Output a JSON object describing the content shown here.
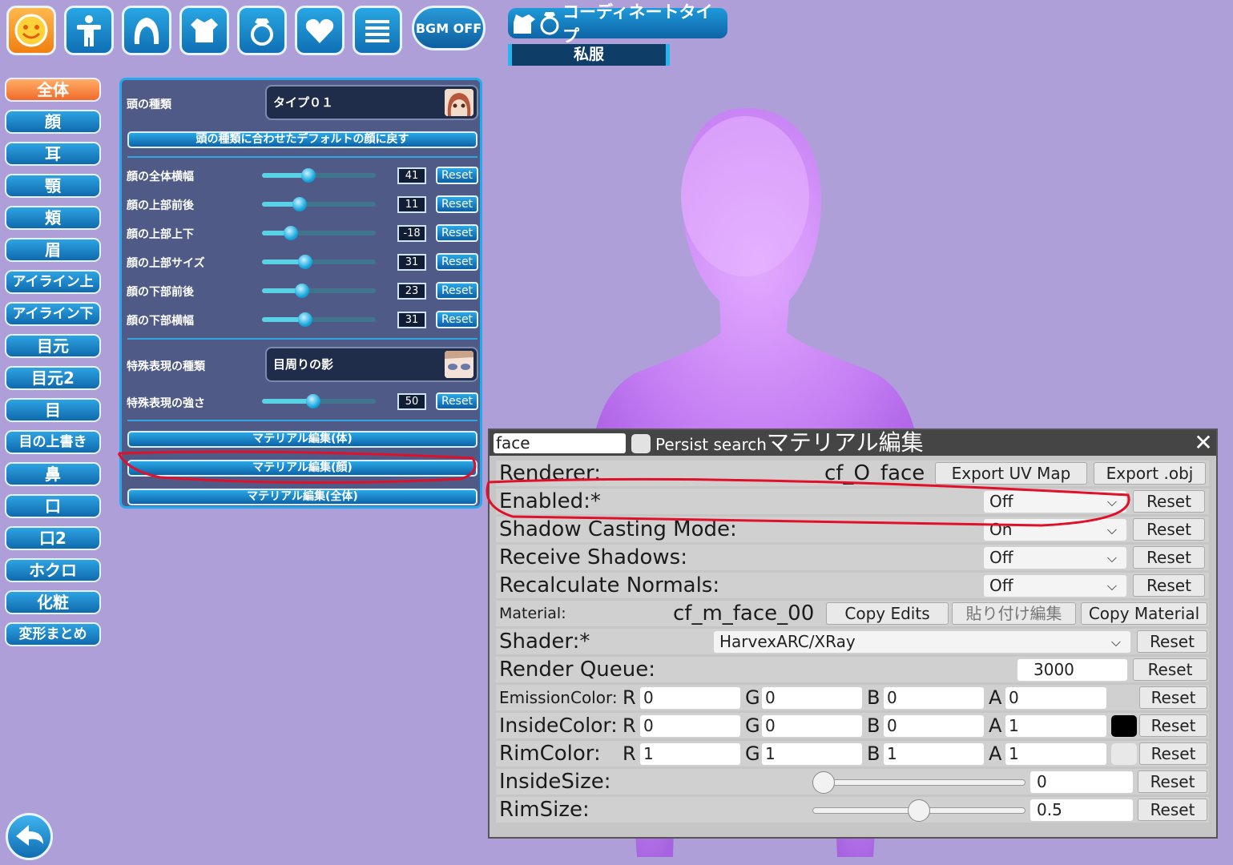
{
  "top_bar": {
    "icons": [
      "smiley-icon",
      "body-icon",
      "hair-icon",
      "outfit-icon",
      "ring-icon",
      "heart-icon",
      "list-icon"
    ],
    "bgm_label": "BGM OFF",
    "coordinate_title": "コーディネートタイプ",
    "coordinate_value": "私服"
  },
  "categories": [
    "全体",
    "顔",
    "耳",
    "顎",
    "頬",
    "眉",
    "アイライン上",
    "アイライン下",
    "目元",
    "目元2",
    "目",
    "目の上書き",
    "鼻",
    "口",
    "口2",
    "ホクロ",
    "化粧",
    "変形まとめ"
  ],
  "face_panel": {
    "head_type_label": "頭の種類",
    "head_type_value": "タイプ０１",
    "default_face_button": "頭の種類に合わせたデフォルトの顔に戻す",
    "sliders": [
      {
        "label": "顔の全体横幅",
        "value": "41",
        "fraction": 0.41
      },
      {
        "label": "顔の上部前後",
        "value": "11",
        "fraction": 0.33
      },
      {
        "label": "顔の上部上下",
        "value": "-18",
        "fraction": 0.25
      },
      {
        "label": "顔の上部サイズ",
        "value": "31",
        "fraction": 0.38
      },
      {
        "label": "顔の下部前後",
        "value": "23",
        "fraction": 0.35
      },
      {
        "label": "顔の下部横幅",
        "value": "31",
        "fraction": 0.38
      }
    ],
    "special_type_label": "特殊表現の種類",
    "special_type_value": "目周りの影",
    "special_strength": {
      "label": "特殊表現の強さ",
      "value": "50",
      "fraction": 0.45
    },
    "reset_label": "Reset",
    "material_buttons": [
      "マテリアル編集(体)",
      "マテリアル編集(顔)",
      "マテリアル編集(全体)"
    ]
  },
  "material_editor": {
    "search_value": "face",
    "persist_label": "Persist search",
    "title": "マテリアル編集",
    "renderer_label": "Renderer:",
    "renderer_value": "cf_O_face",
    "export_uv": "Export UV Map",
    "export_obj": "Export .obj",
    "enabled": {
      "label": "Enabled:*",
      "value": "Off"
    },
    "shadow_casting": {
      "label": "Shadow Casting Mode:",
      "value": "On"
    },
    "receive_shadows": {
      "label": "Receive Shadows:",
      "value": "Off"
    },
    "recalc_normals": {
      "label": "Recalculate Normals:",
      "value": "Off"
    },
    "material_label": "Material:",
    "material_value": "cf_m_face_00",
    "copy_edits": "Copy Edits",
    "paste_edits": "貼り付け編集",
    "copy_material": "Copy Material",
    "shader": {
      "label": "Shader:*",
      "value": "HarvexARC/XRay"
    },
    "render_queue": {
      "label": "Render Queue:",
      "value": "3000"
    },
    "emission": {
      "label": "EmissionColor:",
      "r": "0",
      "g": "0",
      "b": "0",
      "a": "0"
    },
    "inside": {
      "label": "InsideColor:",
      "r": "0",
      "g": "0",
      "b": "0",
      "a": "1",
      "swatch": "#000000"
    },
    "rim": {
      "label": "RimColor:",
      "r": "1",
      "g": "1",
      "b": "1",
      "a": "1",
      "swatch": "#e8e8e8"
    },
    "inside_size": {
      "label": "InsideSize:",
      "value": "0",
      "fraction": 0.0
    },
    "rim_size": {
      "label": "RimSize:",
      "value": "0.5",
      "fraction": 0.5
    },
    "channel_labels": {
      "r": "R",
      "g": "G",
      "b": "B",
      "a": "A"
    },
    "reset_label": "Reset",
    "close_symbol": "✕"
  },
  "colors": {
    "accent": "#1e9ad9",
    "active_category": "#f26a2a",
    "annotation": "#e0102a",
    "background": "#ae9fd9"
  }
}
